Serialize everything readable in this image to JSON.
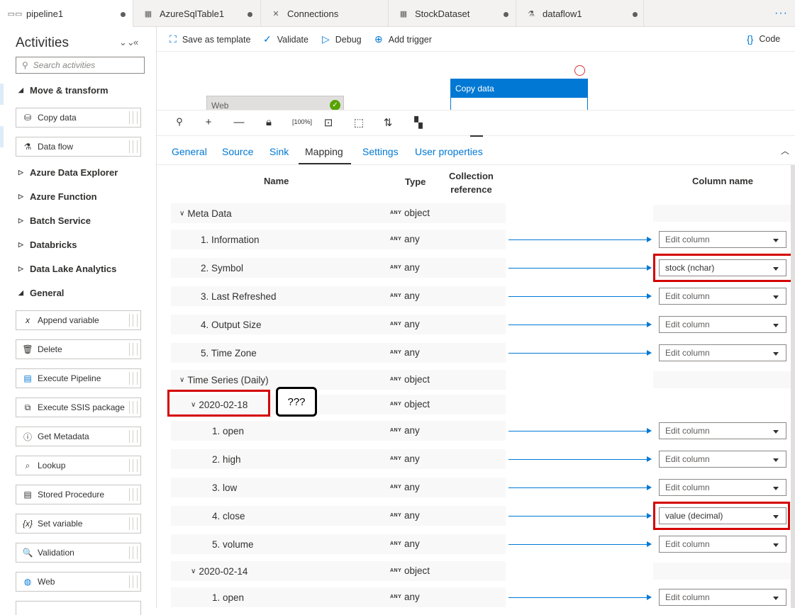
{
  "tabs": [
    {
      "label": "pipeline1",
      "icon": "pipeline-icon",
      "active": true
    },
    {
      "label": "AzureSqlTable1",
      "icon": "table-icon"
    },
    {
      "label": "Connections",
      "icon": "connections-icon"
    },
    {
      "label": "StockDataset",
      "icon": "table-icon"
    },
    {
      "label": "dataflow1",
      "icon": "dataflow-icon"
    }
  ],
  "more_label": "···",
  "sidebar": {
    "title": "Activities",
    "search_placeholder": "Search activities",
    "groups": {
      "move_transform": "Move & transform",
      "data_explorer": "Azure Data Explorer",
      "azure_function": "Azure Function",
      "batch_service": "Batch Service",
      "databricks": "Databricks",
      "data_lake": "Data Lake Analytics",
      "general": "General"
    },
    "activities": {
      "copy_data": "Copy data",
      "data_flow": "Data flow",
      "append_variable": "Append variable",
      "delete": "Delete",
      "execute_pipeline": "Execute Pipeline",
      "execute_ssis": "Execute SSIS package",
      "get_metadata": "Get Metadata",
      "lookup": "Lookup",
      "stored_procedure": "Stored Procedure",
      "set_variable": "Set variable",
      "validation": "Validation",
      "web": "Web"
    }
  },
  "toolbar": {
    "save_template": "Save as template",
    "validate": "Validate",
    "debug": "Debug",
    "add_trigger": "Add trigger",
    "code": "Code"
  },
  "canvas": {
    "web_node": "Web",
    "copy_node": "Copy data"
  },
  "property_tabs": {
    "general": "General",
    "source": "Source",
    "sink": "Sink",
    "mapping": "Mapping",
    "settings": "Settings",
    "user_properties": "User properties"
  },
  "mapping": {
    "headers": {
      "name": "Name",
      "type": "Type",
      "collection_line1": "Collection",
      "collection_line2": "reference",
      "column_name": "Column name"
    },
    "any_badge": "ANY",
    "rows": [
      {
        "name": "Meta Data",
        "type": "object",
        "group": true
      },
      {
        "name": "1. Information",
        "type": "any",
        "column": "Edit column"
      },
      {
        "name": "2. Symbol",
        "type": "any",
        "column": "stock (nchar)"
      },
      {
        "name": "3. Last Refreshed",
        "type": "any",
        "column": "Edit column"
      },
      {
        "name": "4. Output Size",
        "type": "any",
        "column": "Edit column"
      },
      {
        "name": "5. Time Zone",
        "type": "any",
        "column": "Edit column"
      },
      {
        "name": "Time Series (Daily)",
        "type": "object",
        "group": true
      },
      {
        "name": "2020-02-18",
        "type": "object",
        "group": true
      },
      {
        "name": "1. open",
        "type": "any",
        "column": "Edit column"
      },
      {
        "name": "2. high",
        "type": "any",
        "column": "Edit column"
      },
      {
        "name": "3. low",
        "type": "any",
        "column": "Edit column"
      },
      {
        "name": "4. close",
        "type": "any",
        "column": "value (decimal)"
      },
      {
        "name": "5. volume",
        "type": "any",
        "column": "Edit column"
      },
      {
        "name": "2020-02-14",
        "type": "object",
        "group": true
      },
      {
        "name": "1. open",
        "type": "any",
        "column": "Edit column"
      }
    ],
    "callout": "???"
  }
}
